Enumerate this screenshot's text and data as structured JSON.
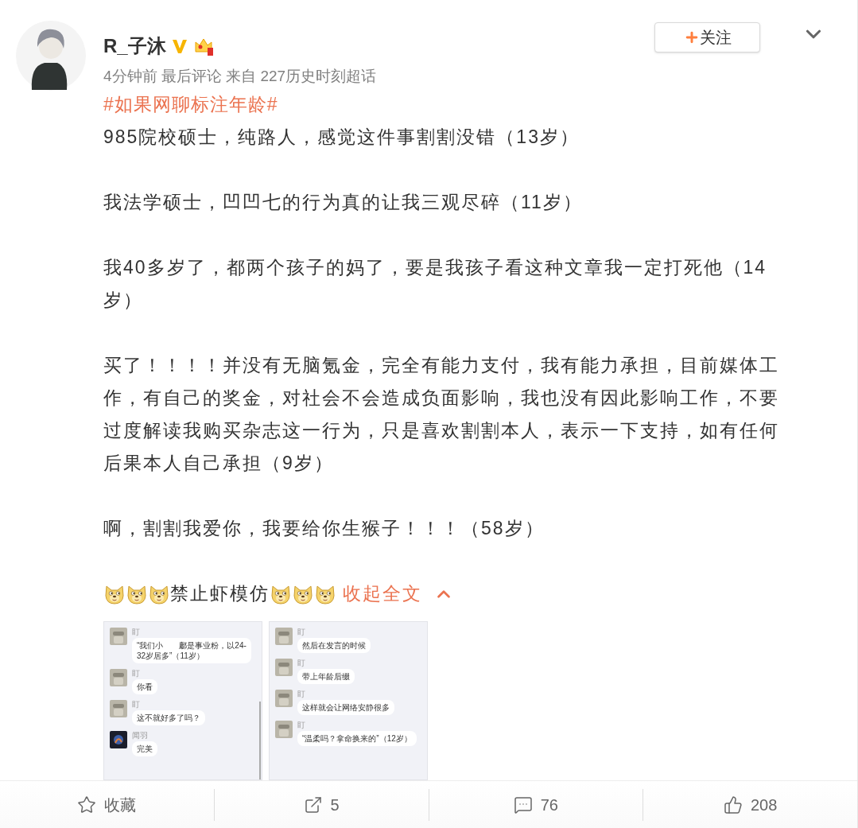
{
  "post": {
    "author": "R_子沐",
    "meta": "4分钟前 最后评论 来自 227历史时刻超话",
    "topic": "#如果网聊标注年龄#",
    "follow_button": {
      "label": "关注"
    },
    "paragraphs": [
      "985院校硕士，纯路人，感觉这件事割割没错（13岁）",
      "我法学硕士，凹凹七的行为真的让我三观尽碎（11岁）",
      "我40多岁了，都两个孩子的妈了，要是我孩子看这种文章我一定打死他（14岁）",
      "买了！！！！并没有无脑氪金，完全有能力支付，我有能力承担，目前媒体工作，有自己的奖金，对社会不会造成负面影响，我也没有因此影响工作，不要过度解读我购买杂志这一行为，只是喜欢割割本人，表示一下支持，如有任何后果本人自己承担（9岁）",
      "啊，割割我爱你，我要给你生猴子！！！（58岁）"
    ],
    "closing": [
      {
        "kind": "emoji"
      },
      {
        "kind": "emoji"
      },
      {
        "kind": "emoji"
      },
      {
        "kind": "text",
        "text": "禁止虾模仿"
      },
      {
        "kind": "emoji"
      },
      {
        "kind": "emoji"
      },
      {
        "kind": "emoji"
      }
    ],
    "collapse_link": "收起全文",
    "images": [
      {
        "messages": [
          {
            "sender": "盯",
            "kind": "light",
            "text": "“我们小　　鄘是事业粉，以24-32岁居多”（11岁）"
          },
          {
            "sender": "盯",
            "kind": "light",
            "text": "你看"
          },
          {
            "sender": "盯",
            "kind": "light",
            "text": "这不就好多了吗？"
          },
          {
            "sender": "闻羽",
            "kind": "dark",
            "text": "完美"
          }
        ]
      },
      {
        "messages": [
          {
            "sender": "盯",
            "kind": "light",
            "text": "然后在发言的时候"
          },
          {
            "sender": "盯",
            "kind": "light",
            "text": "带上年龄后缀"
          },
          {
            "sender": "盯",
            "kind": "light",
            "text": "这样就会让网络安静很多"
          },
          {
            "sender": "盯",
            "kind": "light",
            "text": "“温柔吗？拿命换来的”（12岁）"
          }
        ]
      }
    ],
    "actions": [
      {
        "kind": "favorite",
        "label": "收藏"
      },
      {
        "kind": "share",
        "label": "5"
      },
      {
        "kind": "comment",
        "label": "76"
      },
      {
        "kind": "like",
        "label": "208"
      }
    ]
  }
}
